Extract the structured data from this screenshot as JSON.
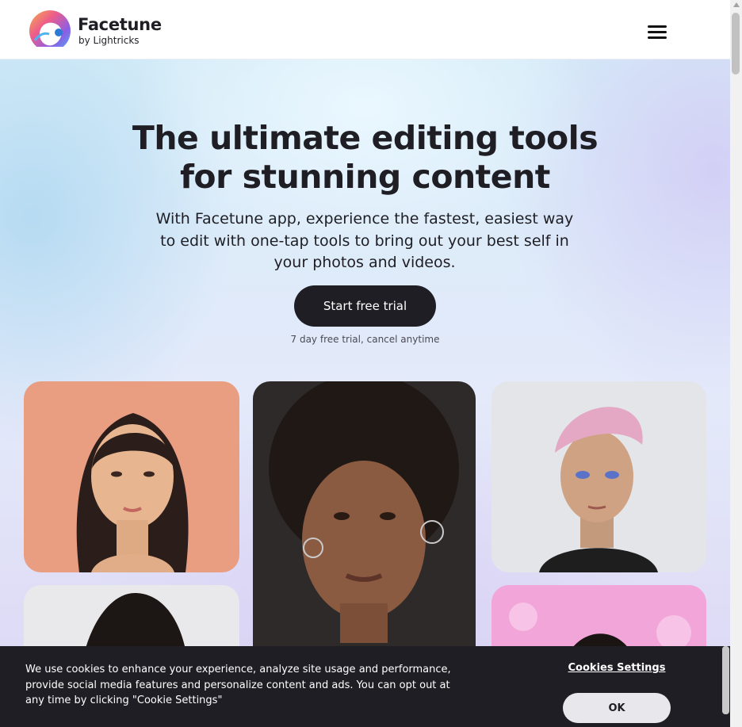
{
  "header": {
    "brand_name": "Facetune",
    "brand_sub": "by Lightricks",
    "menu_icon": "hamburger-menu-icon"
  },
  "hero": {
    "title_line1": "The ultimate editing tools",
    "title_line2": "for stunning content",
    "subtitle": "With Facetune app, experience the fastest, easiest way to edit with one-tap tools to bring out your best self in your photos and videos.",
    "cta_label": "Start free trial",
    "cta_note": "7 day free trial, cancel anytime"
  },
  "gallery": {
    "photos": [
      {
        "subject": "portrait-woman-long-dark-hair",
        "background": "#e99e82"
      },
      {
        "subject": "portrait-woman-curly-hair-pink-shirt",
        "background": "#2e2a2a"
      },
      {
        "subject": "portrait-person-pink-hair",
        "background": "#e3e5e9"
      },
      {
        "subject": "portrait-person-curly-dark-hair",
        "background": "#e9e9ec"
      },
      {
        "subject": "portrait-person-pink-background",
        "background": "#f2a5d8"
      }
    ]
  },
  "cookie_banner": {
    "text": "We use cookies to enhance your experience, analyze site usage and performance, provide social media features and personalize content and ads. You can opt out at any time by clicking \"Cookie Settings\"",
    "settings_label": "Cookies Settings",
    "ok_label": "OK"
  },
  "colors": {
    "ink": "#1e1e24",
    "banner_background": "#1e1e24",
    "ok_button": "#e8e8ec",
    "hero_blue": "#d5ecf8",
    "hero_lavender": "#dcd6f4"
  }
}
